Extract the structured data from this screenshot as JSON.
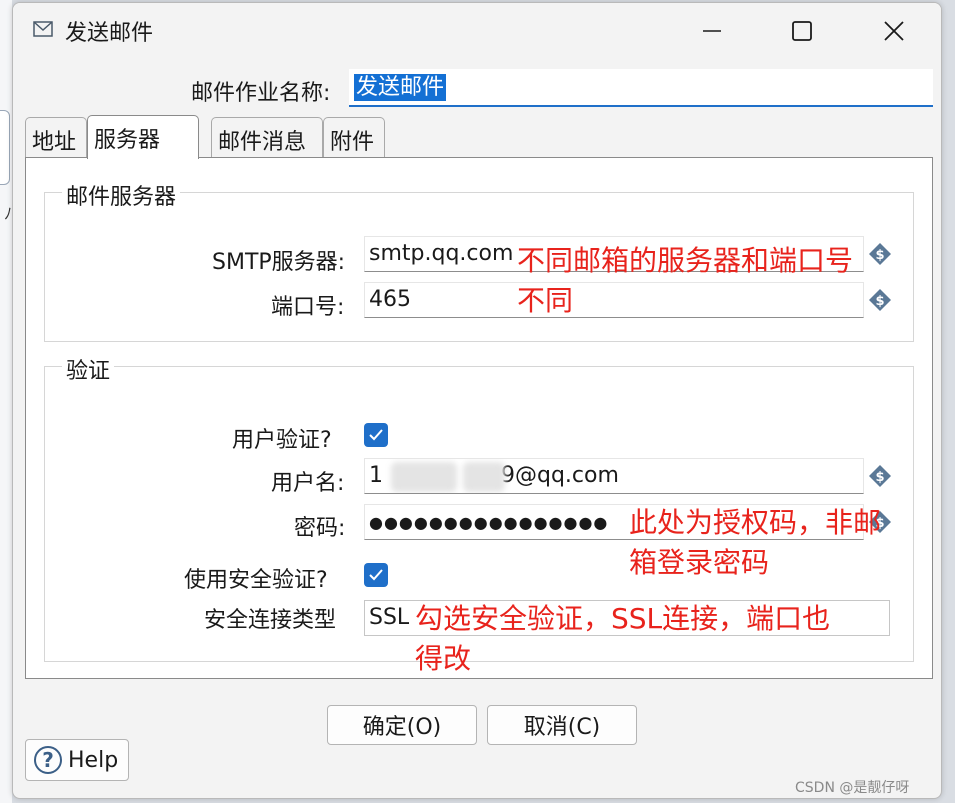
{
  "window": {
    "title": "发送邮件"
  },
  "job_name": {
    "label": "邮件作业名称:",
    "value": "发送邮件"
  },
  "tabs": [
    {
      "label": "地址"
    },
    {
      "label": "服务器"
    },
    {
      "label": "邮件消息"
    },
    {
      "label": "附件"
    }
  ],
  "mail_server": {
    "group_title": "邮件服务器",
    "smtp_label": "SMTP服务器:",
    "smtp_value": "smtp.qq.com",
    "port_label": "端口号:",
    "port_value": "465"
  },
  "auth": {
    "group_title": "验证",
    "user_auth_label": "用户验证?",
    "user_auth_checked": true,
    "username_label": "用户名:",
    "username_prefix": "1",
    "username_suffix": "9@qq.com",
    "password_label": "密码:",
    "password_value": "●●●●●●●●●●●●●●●●",
    "secure_auth_label": "使用安全验证?",
    "secure_auth_checked": true,
    "conn_type_label": "安全连接类型",
    "conn_type_value": "SSL"
  },
  "annotations": {
    "server_note_line1": "不同邮箱的服务器和端口号",
    "server_note_line2": "不同",
    "password_note_line1": "此处为授权码，非邮",
    "password_note_line2": "箱登录密码",
    "ssl_note_line1": "勾选安全验证，SSL连接，端口也",
    "ssl_note_line2": "得改",
    "color": "#e8231c"
  },
  "buttons": {
    "ok": "确定(O)",
    "cancel": "取消(C)",
    "help": "Help"
  },
  "watermark": "CSDN @是靓仔呀",
  "colors": {
    "accent": "#1f6fc9",
    "selection": "#1470d4",
    "var_icon": "#5a7896"
  }
}
